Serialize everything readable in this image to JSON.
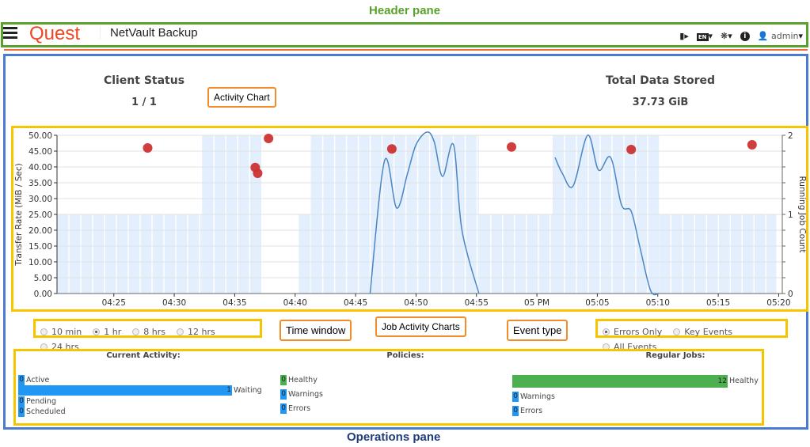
{
  "annotations": {
    "header_pane": "Header pane",
    "operations_pane": "Operations pane",
    "activity_chart": "Activity Chart",
    "time_window": "Time window",
    "job_activity_charts": "Job Activity Charts",
    "event_type": "Event type"
  },
  "header": {
    "logo": "Quest",
    "app_title": "NetVault Backup",
    "lang": "EN",
    "user": "admin",
    "icons": [
      "menu-icon",
      "video-icon",
      "language-icon",
      "plugin-icon",
      "info-icon",
      "user-icon"
    ]
  },
  "stats": {
    "client_status": {
      "label": "Client Status",
      "value": "1 / 1"
    },
    "total_data": {
      "label": "Total Data Stored",
      "value": "37.73 GiB"
    }
  },
  "chart_data": {
    "type": "line",
    "ylabel": "Transfer Rate (MiB / Sec)",
    "y2label": "Running Job Count",
    "ylim": [
      0,
      50
    ],
    "y2lim": [
      0,
      2
    ],
    "yticks": [
      "0.00",
      "5.00",
      "10.00",
      "15.00",
      "20.00",
      "25.00",
      "30.00",
      "35.00",
      "40.00",
      "45.00",
      "50.00"
    ],
    "y2ticks": [
      "0",
      "1",
      "2"
    ],
    "xlim": [
      "04:20:18",
      "05:20:18"
    ],
    "xticks": [
      [
        "04:25",
        "04:25"
      ],
      [
        "04:30",
        "04:30"
      ],
      [
        "04:35",
        "04:35"
      ],
      [
        "04:40",
        "04:40"
      ],
      [
        "04:45",
        "04:45"
      ],
      [
        "04:50",
        "04:50"
      ],
      [
        "04:55",
        "04:55"
      ],
      [
        "05:00",
        "05 PM"
      ],
      [
        "05:05",
        "05:05"
      ],
      [
        "05:10",
        "05:10"
      ],
      [
        "05:15",
        "05:15"
      ],
      [
        "05:20",
        "05:20"
      ]
    ],
    "grid": true,
    "colors": {
      "rate": "#4a86c5",
      "jobs": "#e3effd",
      "events": "#cc3333"
    },
    "running_jobs": [
      [
        "04:20:18",
        "04:32:18",
        1
      ],
      [
        "04:32:18",
        "04:37:12",
        2
      ],
      [
        "04:37:12",
        "04:40:18",
        0
      ],
      [
        "04:40:18",
        "04:41:18",
        1
      ],
      [
        "04:41:18",
        "04:55:12",
        2
      ],
      [
        "04:55:12",
        "05:01:18",
        1
      ],
      [
        "05:01:18",
        "05:10:06",
        2
      ],
      [
        "05:10:06",
        "05:19:48",
        1
      ]
    ],
    "transfer_rate": [
      [
        "04:46:12",
        0
      ],
      [
        "04:47:24",
        42
      ],
      [
        "04:48:24",
        27
      ],
      [
        "04:49:18",
        38
      ],
      [
        "04:50:00",
        47
      ],
      [
        "04:50:54",
        51
      ],
      [
        "04:51:30",
        48
      ],
      [
        "04:52:12",
        37
      ],
      [
        "04:53:06",
        47
      ],
      [
        "04:53:48",
        20
      ],
      [
        "04:55:12",
        0
      ],
      [
        "05:00:06",
        0
      ],
      [
        "05:01:30",
        43
      ],
      [
        "05:02:06",
        38
      ],
      [
        "05:03:00",
        34
      ],
      [
        "05:04:12",
        50
      ],
      [
        "05:05:06",
        39
      ],
      [
        "05:06:06",
        43
      ],
      [
        "05:07:00",
        28
      ],
      [
        "05:07:48",
        26
      ],
      [
        "05:08:30",
        15
      ],
      [
        "05:09:24",
        1
      ],
      [
        "05:10:06",
        0
      ]
    ],
    "events": [
      [
        "04:27:48",
        46
      ],
      [
        "04:36:42",
        39.8
      ],
      [
        "04:36:54",
        38
      ],
      [
        "04:37:48",
        49
      ],
      [
        "04:48:00",
        45.7
      ],
      [
        "04:57:54",
        46.3
      ],
      [
        "05:07:48",
        45.5
      ],
      [
        "05:17:48",
        47
      ]
    ]
  },
  "time_window": {
    "options": [
      "10 min",
      "1 hr",
      "8 hrs",
      "12 hrs",
      "24 hrs"
    ],
    "selected": "1 hr"
  },
  "event_type": {
    "options": [
      "Errors Only",
      "Key Events",
      "All Events"
    ],
    "selected": "Errors Only"
  },
  "jobs": {
    "current": {
      "title": "Current Activity:",
      "rows": [
        {
          "label": "Active",
          "value": "0",
          "frac": 0
        },
        {
          "label": "Waiting",
          "value": "1",
          "frac": 1
        },
        {
          "label": "Pending",
          "value": "0",
          "frac": 0
        },
        {
          "label": "Scheduled",
          "value": "0",
          "frac": 0
        }
      ]
    },
    "policies": {
      "title": "Policies:",
      "rows": [
        {
          "label": "Healthy",
          "value": "0",
          "frac": 0,
          "color": "green"
        },
        {
          "label": "Warnings",
          "value": "0",
          "frac": 0
        },
        {
          "label": "Errors",
          "value": "0",
          "frac": 0
        }
      ]
    },
    "regular": {
      "title": "Regular Jobs:",
      "rows": [
        {
          "label": "Healthy",
          "value": "12",
          "frac": 1,
          "color": "green"
        },
        {
          "label": "Warnings",
          "value": "0",
          "frac": 0
        },
        {
          "label": "Errors",
          "value": "0",
          "frac": 0
        }
      ]
    }
  }
}
